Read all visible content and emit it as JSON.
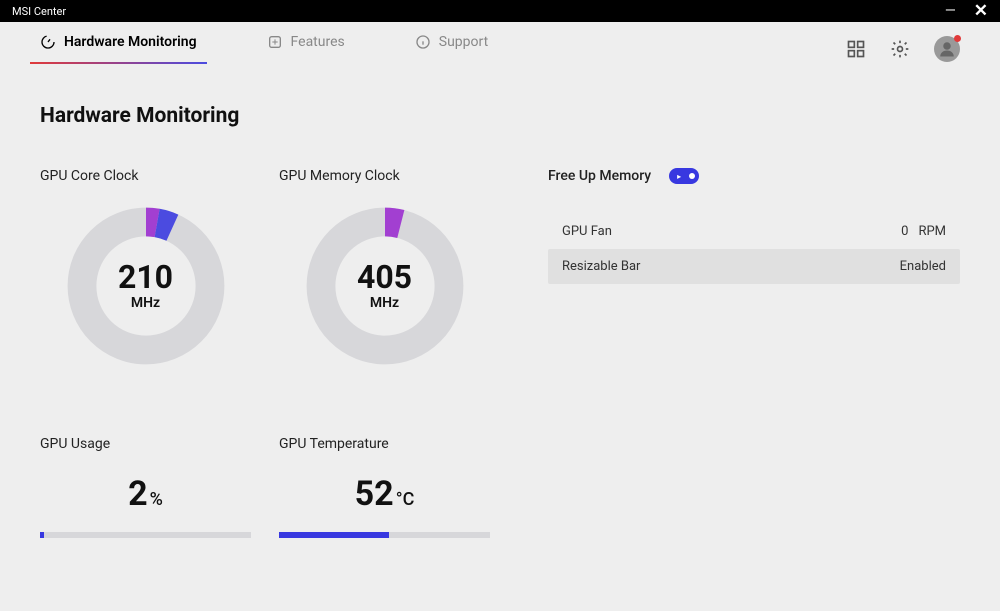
{
  "window": {
    "title": "MSI Center"
  },
  "nav": {
    "tabs": [
      {
        "label": "Hardware Monitoring",
        "active": true
      },
      {
        "label": "Features",
        "active": false
      },
      {
        "label": "Support",
        "active": false
      }
    ]
  },
  "page": {
    "title": "Hardware Monitoring"
  },
  "metrics": {
    "coreClock": {
      "label": "GPU Core Clock",
      "value": "210",
      "unit": "MHz",
      "arc1_pct": 3,
      "arc2_pct": 4
    },
    "memoryClock": {
      "label": "GPU Memory Clock",
      "value": "405",
      "unit": "MHz",
      "arc1_pct": 4,
      "arc2_pct": 0
    },
    "usage": {
      "label": "GPU Usage",
      "value": "2",
      "unit": "%",
      "fill_pct": 2
    },
    "temperature": {
      "label": "GPU Temperature",
      "value": "52",
      "unit": "°C",
      "fill_pct": 52
    }
  },
  "side": {
    "freeMemory": {
      "label": "Free Up Memory",
      "on": true
    },
    "rows": [
      {
        "label": "GPU Fan",
        "value": "0",
        "unit": "RPM",
        "alt": false
      },
      {
        "label": "Resizable Bar",
        "value": "Enabled",
        "unit": "",
        "alt": true
      }
    ]
  },
  "chart_data": [
    {
      "type": "pie",
      "title": "GPU Core Clock",
      "values": [
        7,
        93
      ],
      "value_label": "210 MHz"
    },
    {
      "type": "pie",
      "title": "GPU Memory Clock",
      "values": [
        4,
        96
      ],
      "value_label": "405 MHz"
    },
    {
      "type": "bar",
      "title": "GPU Usage",
      "categories": [
        "usage"
      ],
      "values": [
        2
      ],
      "ylim": [
        0,
        100
      ],
      "ylabel": "%"
    },
    {
      "type": "bar",
      "title": "GPU Temperature",
      "categories": [
        "temp"
      ],
      "values": [
        52
      ],
      "ylim": [
        0,
        100
      ],
      "ylabel": "°C"
    }
  ]
}
